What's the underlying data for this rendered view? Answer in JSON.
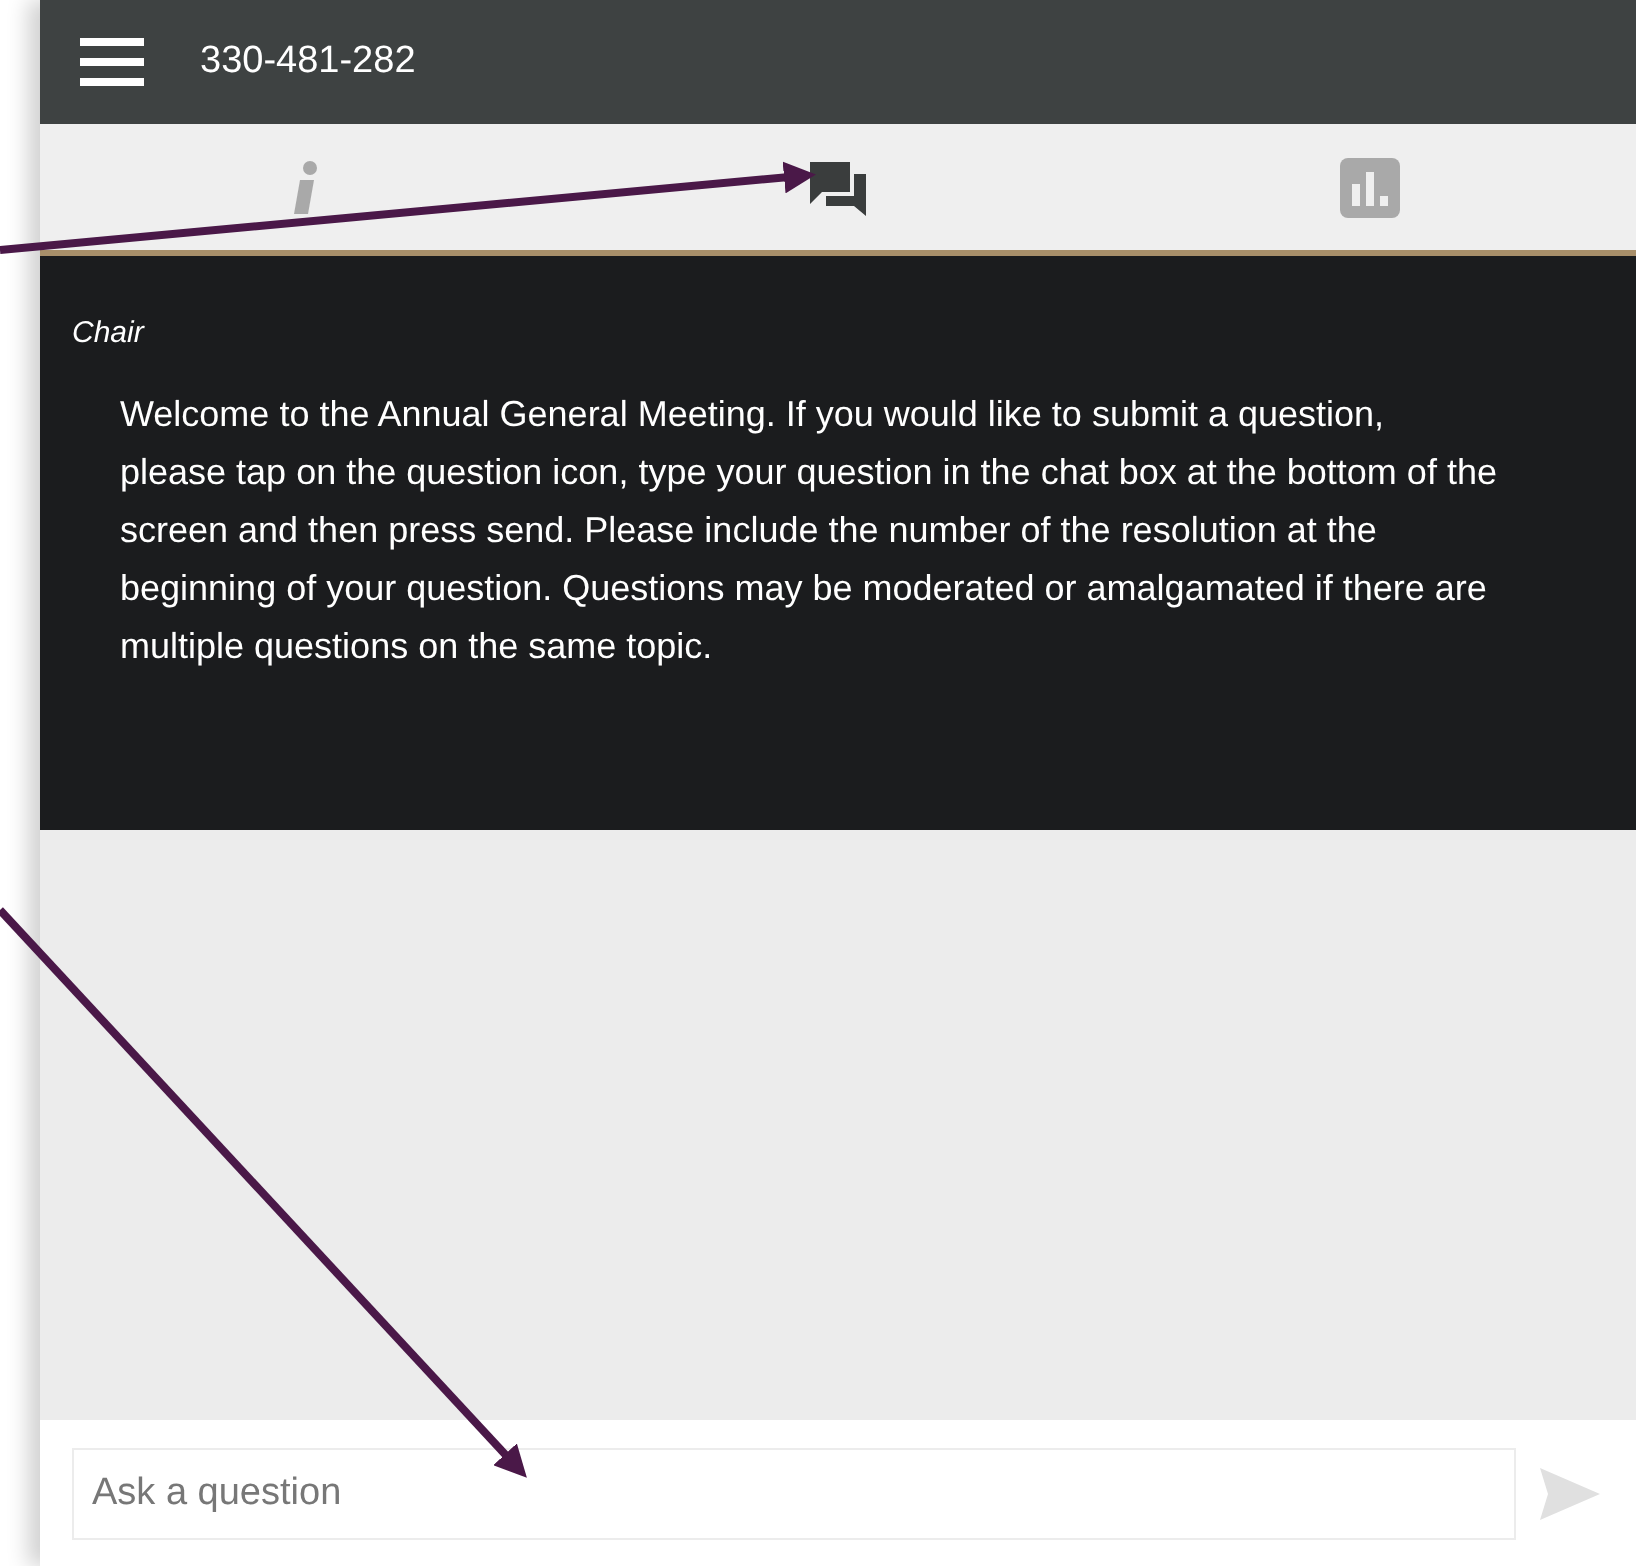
{
  "header": {
    "title": "330-481-282"
  },
  "tabs": [
    {
      "kind": "info",
      "selected": false
    },
    {
      "kind": "chat",
      "selected": true
    },
    {
      "kind": "chart",
      "selected": false
    }
  ],
  "messages": [
    {
      "sender": "Chair",
      "text": "Welcome to the Annual General Meeting. If you would like to submit a question, please tap on the question icon, type your question in the chat box at the bottom of the screen and then press send. Please include the number of the resolution at the beginning of your question. Questions may be moderated or amalgamated if there are multiple questions on the same topic."
    }
  ],
  "composer": {
    "placeholder": "Ask a question"
  }
}
